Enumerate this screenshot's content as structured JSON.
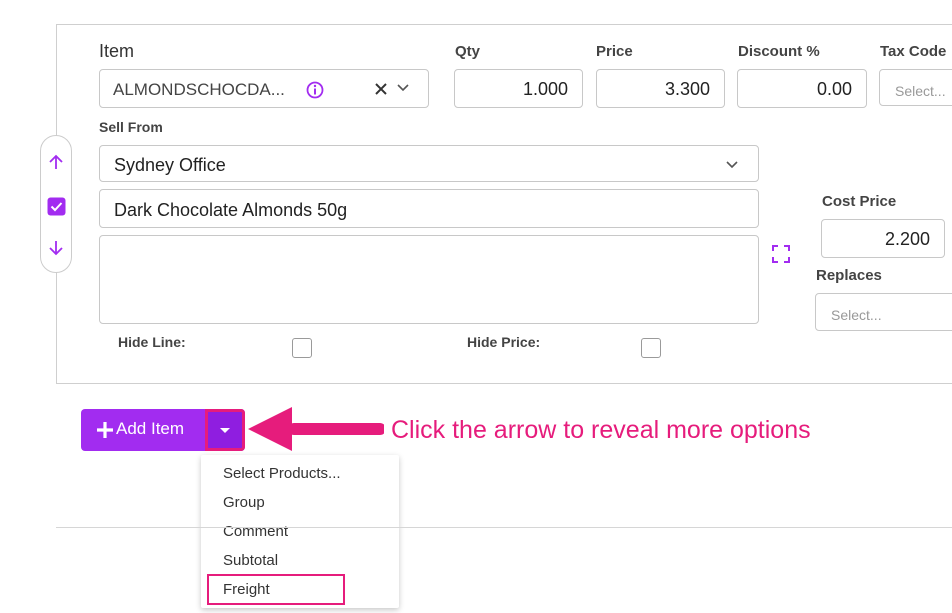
{
  "colors": {
    "accent": "#a22cf0",
    "annotation": "#e61c7c"
  },
  "line": {
    "item": {
      "label": "Item",
      "value": "ALMONDSCHOCDA...",
      "info_icon": "info-circle-icon",
      "clear_icon": "close-icon",
      "dropdown_icon": "chevron-down-icon"
    },
    "qty": {
      "label": "Qty",
      "value": "1.000"
    },
    "price": {
      "label": "Price",
      "value": "3.300"
    },
    "discount": {
      "label": "Discount %",
      "value": "0.00"
    },
    "tax_code": {
      "label": "Tax Code",
      "placeholder": "Select..."
    },
    "sell_from": {
      "label": "Sell From",
      "value": "Sydney Office"
    },
    "description": "Dark Chocolate Almonds 50g",
    "notes": "",
    "cost_price": {
      "label": "Cost Price",
      "value": "2.200"
    },
    "replaces": {
      "label": "Replaces",
      "placeholder": "Select..."
    },
    "hide_line": {
      "label": "Hide Line:",
      "checked": false
    },
    "hide_price": {
      "label": "Hide Price:",
      "checked": false
    },
    "selected": true
  },
  "add_item": {
    "label": "Add Item",
    "icon": "plus-icon"
  },
  "menu": {
    "items": [
      "Select Products...",
      "Group",
      "Comment",
      "Subtotal",
      "Freight"
    ]
  },
  "callout": "Click the arrow to reveal more options"
}
